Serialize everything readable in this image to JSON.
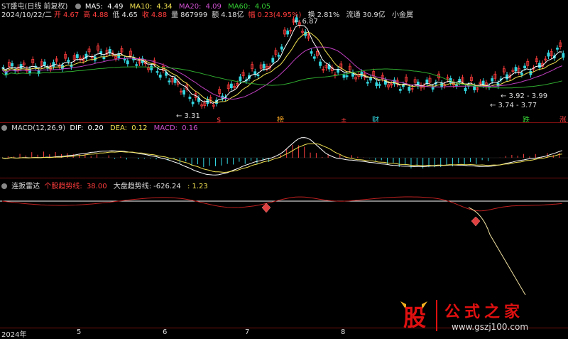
{
  "header": {
    "stock_title": "ST盛屯(日线 前复权)",
    "ma5_label": "MA5:",
    "ma5_value": "4.49",
    "ma10_label": "MA10:",
    "ma10_value": "4.34",
    "ma20_label": "MA20:",
    "ma20_value": "4.09",
    "ma60_label": "MA60:",
    "ma60_value": "4.05",
    "date": "2024/10/22/二",
    "open_label": "开",
    "open_value": "4.67",
    "high_label": "高",
    "high_value": "4.88",
    "low_label": "低",
    "low_value": "4.65",
    "close_label": "收",
    "close_value": "4.88",
    "volume_label": "量",
    "volume_value": "867999",
    "amount_label": "额",
    "amount_value": "4.18亿",
    "change_label": "幅",
    "change_value": "0.23(4.95%)",
    "turnover_label": "换",
    "turnover_value": "2.81%",
    "float_label": "流通",
    "float_value": "30.9亿",
    "size_label": "小金属"
  },
  "price_annotations": {
    "high_mark": "6.87",
    "low_mark": "3.31",
    "right_mark1": "3.92",
    "right_mark2": "3.99",
    "right_mark3": "3.74",
    "right_mark4": "3.77"
  },
  "event_markers": [
    {
      "label": "$"
    },
    {
      "label": "榜"
    },
    {
      "label": "±"
    },
    {
      "label": "财"
    },
    {
      "label": "跌"
    },
    {
      "label": "涨"
    }
  ],
  "macd": {
    "title": "MACD(12,26,9)",
    "dif_label": "DIF:",
    "dif_value": "0.20",
    "dea_label": "DEA:",
    "dea_value": "0.12",
    "macd_label": "MACD:",
    "macd_value": "0.16"
  },
  "radar": {
    "title": "连扳雷达",
    "stock_trend_label": "个股趋势线:",
    "stock_trend_value": "38.00",
    "market_trend_label": "大盘趋势线:",
    "market_trend_value": "-626.24",
    "extra_value": ": 1.23"
  },
  "x_axis": {
    "labels": [
      "2024年",
      "5",
      "6",
      "7",
      "8"
    ]
  },
  "watermark": {
    "logo_char": "股",
    "site_name": "公式之家",
    "url": "www.gszj100.com"
  },
  "colors": {
    "up": "#ff3c3c",
    "down": "#33d6e0",
    "ma5": "#ffffff",
    "ma10": "#f0e050",
    "ma20": "#c040c0",
    "ma60": "#2faa2f",
    "divider": "#7a1010"
  }
}
